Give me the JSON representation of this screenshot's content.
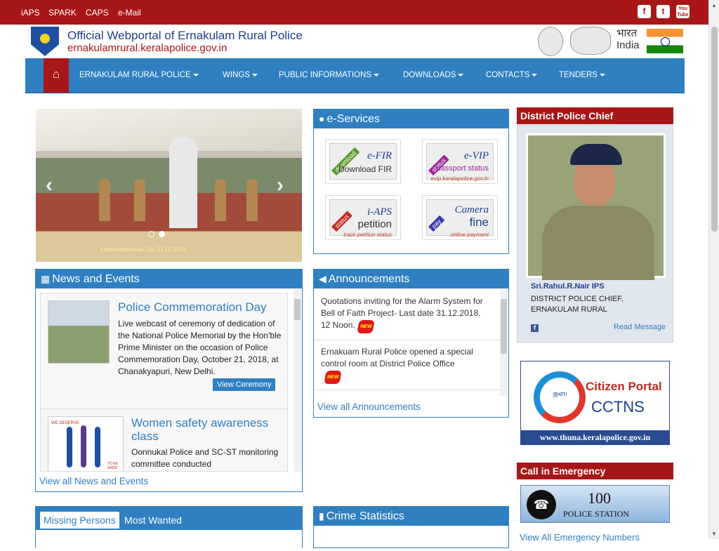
{
  "topbar": {
    "links": [
      "iAPS",
      "SPARK",
      "CAPS",
      "e-Mail"
    ],
    "social": [
      "facebook-icon",
      "twitter-icon",
      "youtube-icon"
    ],
    "youtube_label": "You Tube"
  },
  "header": {
    "title": "Official Webportal of Ernakulam Rural Police",
    "url": "ernakulamrural.keralapolice.gov.in",
    "india_hindi": "भारत",
    "india_en": "India"
  },
  "nav": {
    "home_icon": "home-icon",
    "items": [
      "ERNAKULAM RURAL POLICE",
      "WINGS",
      "PUBLIC INFORMATIONS",
      "DOWNLOADS",
      "CONTACTS",
      "TENDERS"
    ]
  },
  "slider": {
    "caption": "Commemoration Day 21.10.2018",
    "prev": "‹",
    "next": "›"
  },
  "eservices": {
    "title": "e-Services",
    "items": [
      {
        "band": "download",
        "t1": "e-FIR",
        "t2": "Download FIR",
        "t3": ""
      },
      {
        "band": "status",
        "t1": "e-VIP",
        "t2": "passport status",
        "t3": "evip.keralapolice.gov.in"
      },
      {
        "band": "status",
        "t1": "i-APS",
        "t2": "petition",
        "t3": "track petition status"
      },
      {
        "band": "pay",
        "t1": "Camera",
        "t2": "fine",
        "t3": "online payment"
      }
    ]
  },
  "news": {
    "title": "News and Events",
    "items": [
      {
        "title": "Police Commemoration Day",
        "text": "Live webcast of ceremony of dedication of the National Police Memorial by the Hon'ble Prime Minister on the occasion of Police Commemoration Day, October 21, 2018, at Chanakyapuri, New Delhi.",
        "button": "View Ceremony"
      },
      {
        "title": "Women safety awareness class",
        "text": "Oonnukal Police and SC-ST monitoring committee conducted",
        "thumb_text_1": "WE DESERVE",
        "thumb_text_2": "TO BE SAFE!"
      }
    ],
    "view_all": "View all News and Events"
  },
  "announcements": {
    "title": "Announcements",
    "items": [
      {
        "text": "Quotations inviting for the Alarm System for Bell of Faith Project- Last date 31.12.2018, 12 Noon.",
        "badge": "NEW"
      },
      {
        "text": "Ernakuam Rural Police opened a special control room at District Police Office",
        "badge": "NEW"
      }
    ],
    "view_all": "View all Announcements"
  },
  "chief": {
    "heading": "District Police Chief",
    "name": "Sri.Rahul.R.Nair IPS",
    "designation_1": "DISTRICT POLICE CHIEF,",
    "designation_2": "ERNAKULAM RURAL",
    "read_message": "Read Message"
  },
  "cctns": {
    "malayalam": "തുണ",
    "line1": "Citizen Portal",
    "line2": "CCTNS",
    "url": "www.thuna.keralapolice.gov.in"
  },
  "emergency": {
    "heading": "Call in Emergency",
    "number": "100",
    "label": "POLICE STATION",
    "view_all": "View All Emergency Numbers"
  },
  "bottom": {
    "tabs": [
      "Missing Persons",
      "Most Wanted"
    ],
    "crime_stats": "Crime Statistics"
  },
  "colors": {
    "topbar": "#a81717",
    "nav": "#2f7fc1",
    "accent_blue": "#2f7fc1",
    "brand_red": "#a81717"
  }
}
